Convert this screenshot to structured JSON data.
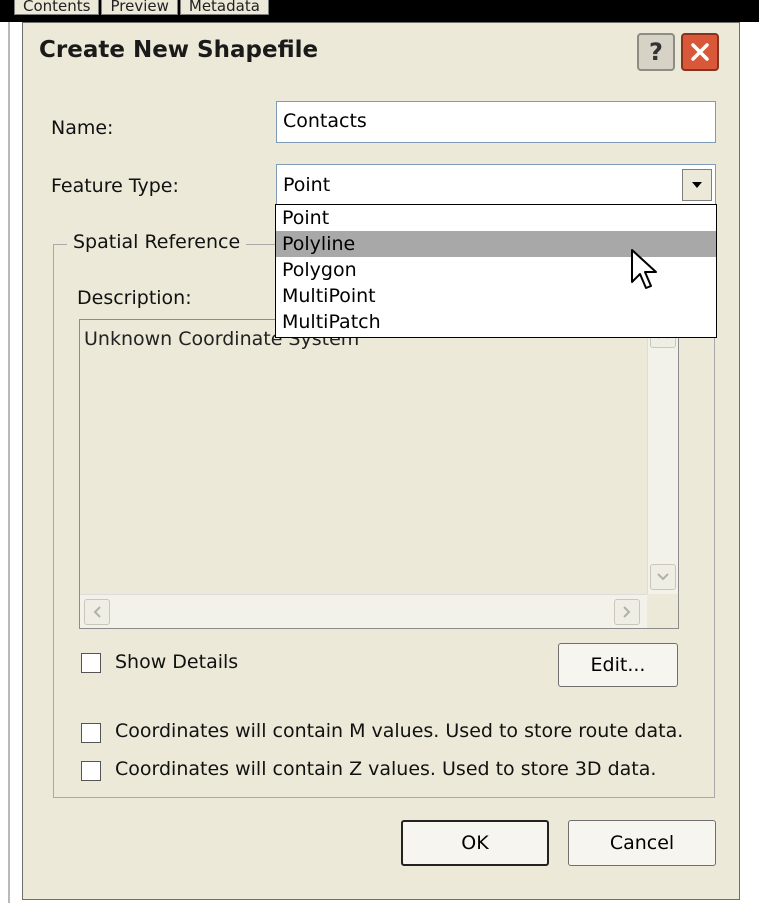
{
  "background": {
    "tabs": [
      "Contents",
      "Preview",
      "Metadata"
    ]
  },
  "dialog": {
    "title": "Create New Shapefile",
    "help_label": "?",
    "name_label": "Name:",
    "name_value": "Contacts",
    "feature_type_label": "Feature Type:",
    "feature_type_value": "Point",
    "feature_type_options": [
      "Point",
      "Polyline",
      "Polygon",
      "MultiPoint",
      "MultiPatch"
    ],
    "feature_type_highlighted": "Polyline",
    "spatial_reference_legend": "Spatial Reference",
    "description_label": "Description:",
    "description_text": "Unknown Coordinate System",
    "show_details_label": "Show Details",
    "show_details_checked": false,
    "edit_label": "Edit...",
    "m_values_label": "Coordinates will contain M values. Used to store route data.",
    "m_values_checked": false,
    "z_values_label": "Coordinates will contain Z values. Used to store 3D data.",
    "z_values_checked": false,
    "ok_label": "OK",
    "cancel_label": "Cancel"
  },
  "colors": {
    "dialog_bg": "#ece9d8",
    "close_button": "#d9583a",
    "selection": "#a8a8a8"
  },
  "icons": [
    "help-icon",
    "close-icon",
    "dropdown-arrow-icon",
    "scroll-up-icon",
    "scroll-down-icon",
    "scroll-left-icon",
    "scroll-right-icon",
    "mouse-cursor-icon"
  ]
}
